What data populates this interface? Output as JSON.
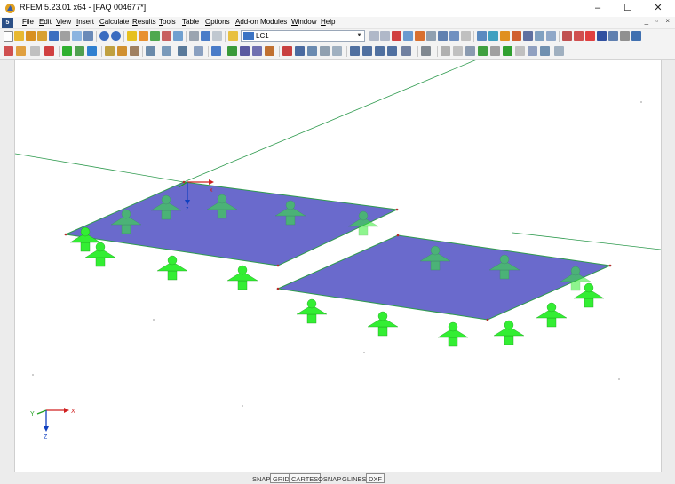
{
  "window": {
    "title": "RFEM 5.23.01 x64 - [FAQ 004677*]",
    "minimize": "–",
    "maximize": "☐",
    "close": "✕"
  },
  "menu": {
    "items": [
      "File",
      "Edit",
      "View",
      "Insert",
      "Calculate",
      "Results",
      "Tools",
      "Table",
      "Options",
      "Add-on Modules",
      "Window",
      "Help"
    ],
    "mdi_controls": "_ ▫ ×"
  },
  "toolbar": {
    "load_case": "LC1"
  },
  "axes": {
    "x": "X",
    "y": "Y",
    "z": "Z"
  },
  "statusbar": {
    "buttons": [
      "SNAP",
      "GRID",
      "CARTES",
      "OSNAP",
      "GLINES",
      "DXF"
    ]
  },
  "colors": {
    "plate": "#6a6acc",
    "support": "#33ee33",
    "line": "#2e9a4e"
  }
}
